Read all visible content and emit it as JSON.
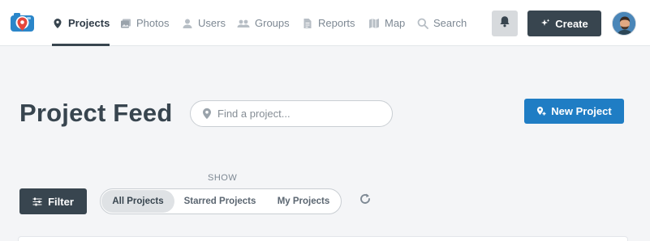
{
  "nav": {
    "items": [
      {
        "label": "Projects",
        "icon": "map-pin-icon",
        "active": true
      },
      {
        "label": "Photos",
        "icon": "photos-icon",
        "active": false
      },
      {
        "label": "Users",
        "icon": "user-icon",
        "active": false
      },
      {
        "label": "Groups",
        "icon": "groups-icon",
        "active": false
      },
      {
        "label": "Reports",
        "icon": "report-icon",
        "active": false
      },
      {
        "label": "Map",
        "icon": "map-icon",
        "active": false
      },
      {
        "label": "Search",
        "icon": "search-icon",
        "active": false
      }
    ],
    "create_label": "Create",
    "logo_icon": "camera-pin-logo",
    "bell_icon": "bell-icon"
  },
  "page": {
    "title": "Project Feed",
    "search_placeholder": "Find a project...",
    "new_project_label": "New Project"
  },
  "filters": {
    "show_label": "SHOW",
    "filter_label": "Filter",
    "segments": [
      {
        "label": "All Projects",
        "active": true
      },
      {
        "label": "Starred Projects",
        "active": false
      },
      {
        "label": "My Projects",
        "active": false
      }
    ],
    "refresh_icon": "refresh-icon"
  },
  "colors": {
    "primary_dark": "#38454f",
    "accent_blue": "#1f7dc4",
    "page_bg": "#f4f5f7",
    "logo_blue": "#2b86c9",
    "logo_red": "#e5473c"
  }
}
